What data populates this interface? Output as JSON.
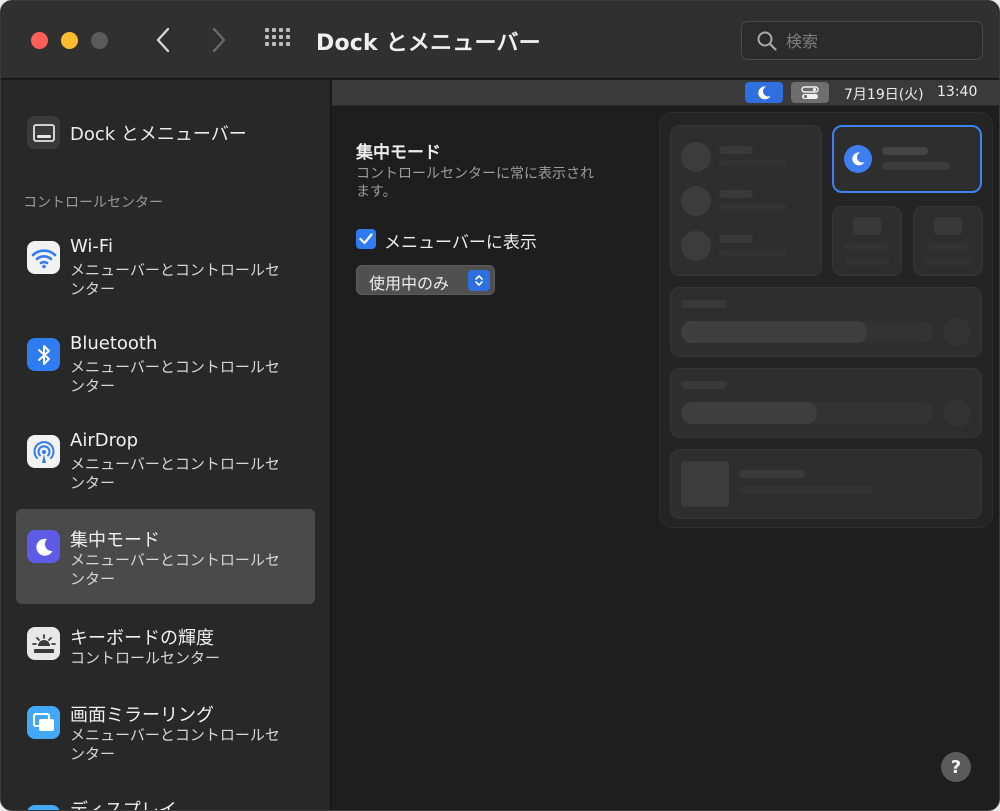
{
  "window": {
    "title": "Dock とメニューバー",
    "search_placeholder": "検索"
  },
  "sidebar": {
    "top_item": {
      "label": "Dock とメニューバー",
      "icon": "dock-icon"
    },
    "section_header": "コントロールセンター",
    "items": [
      {
        "title": "Wi-Fi",
        "subtitle": "メニューバーとコントロールセンター",
        "icon": "wifi-icon",
        "selected": false
      },
      {
        "title": "Bluetooth",
        "subtitle": "メニューバーとコントロールセンター",
        "icon": "bluetooth-icon",
        "selected": false
      },
      {
        "title": "AirDrop",
        "subtitle": "メニューバーとコントロールセンター",
        "icon": "airdrop-icon",
        "selected": false
      },
      {
        "title": "集中モード",
        "subtitle": "メニューバーとコントロールセンター",
        "icon": "moon-icon",
        "selected": true
      },
      {
        "title": "キーボードの輝度",
        "subtitle": "コントロールセンター",
        "icon": "keyboard-brightness-icon",
        "selected": false
      },
      {
        "title": "画面ミラーリング",
        "subtitle": "メニューバーとコントロールセンター",
        "icon": "screen-mirroring-icon",
        "selected": false
      },
      {
        "title": "ディスプレイ",
        "subtitle": "",
        "icon": "display-icon",
        "selected": false
      }
    ]
  },
  "menubar_preview": {
    "date": "7月19日(火)",
    "time": "13:40"
  },
  "main": {
    "section_title": "集中モード",
    "section_description": "コントロールセンターに常に表示されます。",
    "show_in_menubar_label": "メニューバーに表示",
    "show_in_menubar_checked": true,
    "display_option_value": "使用中のみ"
  },
  "help_label": "?",
  "colors": {
    "accent": "#2f7bf0",
    "close": "#ff5f57",
    "minimize": "#febc2e",
    "focus_icon": "#5e5ce6"
  }
}
